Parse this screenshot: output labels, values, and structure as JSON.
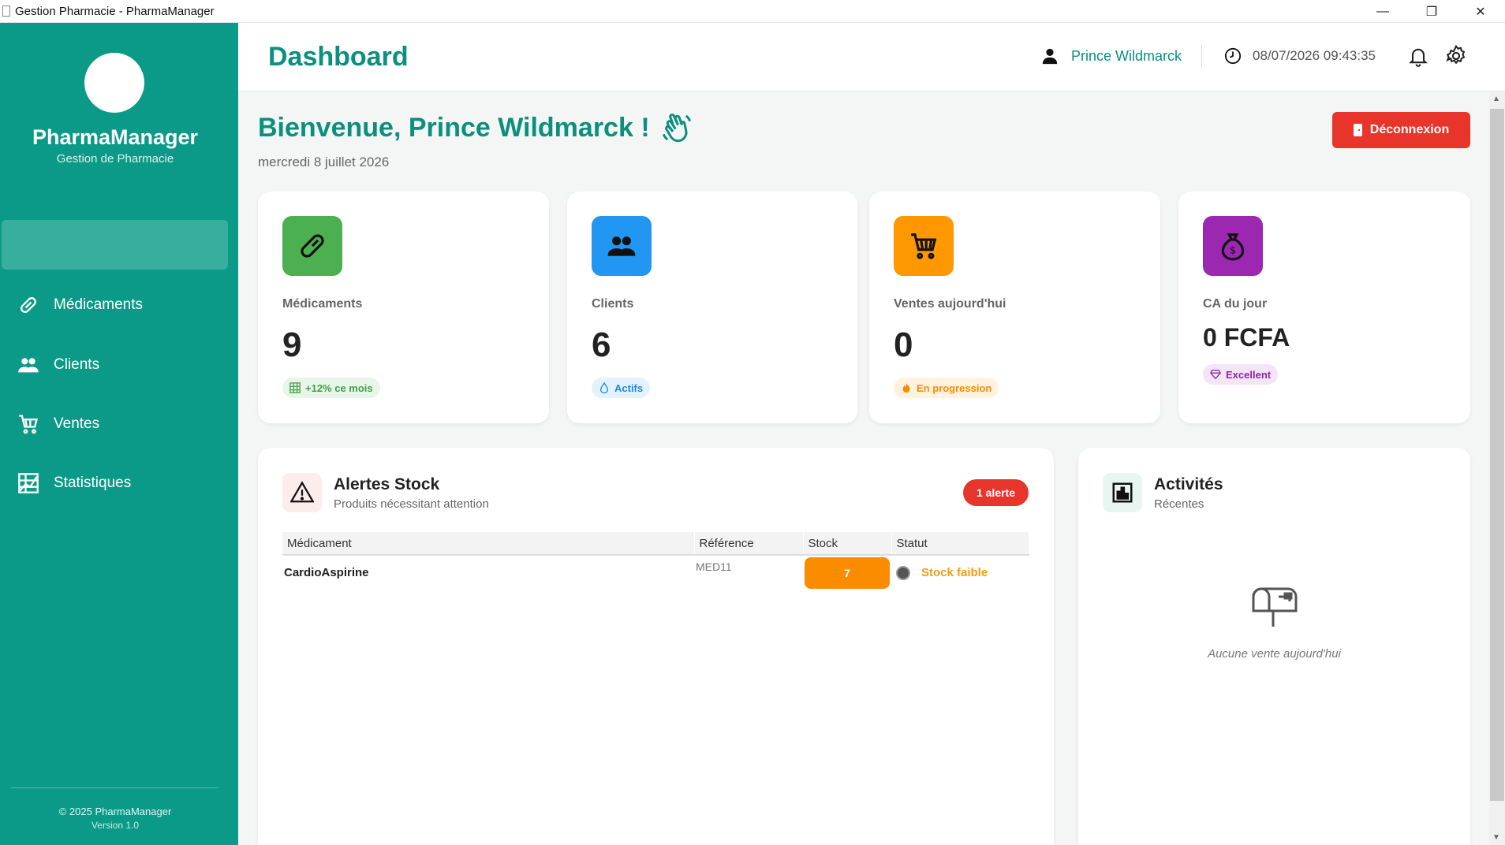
{
  "window": {
    "title": "Gestion Pharmacie - PharmaManager",
    "minimize": "—",
    "maximize": "❐",
    "close": "✕"
  },
  "sidebar": {
    "brand": "PharmaManager",
    "subtitle": "Gestion de Pharmacie",
    "items": [
      {
        "label": "Médicaments",
        "icon": "pill-icon"
      },
      {
        "label": "Clients",
        "icon": "users-icon"
      },
      {
        "label": "Ventes",
        "icon": "cart-icon"
      },
      {
        "label": "Statistiques",
        "icon": "chart-icon"
      }
    ],
    "copyright": "© 2025 PharmaManager",
    "version": "Version 1.0"
  },
  "header": {
    "title": "Dashboard",
    "user": "Prince Wildmarck",
    "datetime": "08/07/2026 09:43:35"
  },
  "welcome": {
    "greeting": "Bienvenue, Prince Wildmarck !",
    "date": "mercredi 8 juillet 2026",
    "logout": "Déconnexion"
  },
  "stats": [
    {
      "label": "Médicaments",
      "value": "9",
      "badge": "+12% ce mois",
      "color": "#4caf50"
    },
    {
      "label": "Clients",
      "value": "6",
      "badge": "Actifs",
      "color": "#2196f3"
    },
    {
      "label": "Ventes aujourd'hui",
      "value": "0",
      "badge": "En progression",
      "color": "#ff9800"
    },
    {
      "label": "CA du jour",
      "value": "0 FCFA",
      "badge": "Excellent",
      "color": "#9c27b0"
    }
  ],
  "alerts": {
    "title": "Alertes Stock",
    "subtitle": "Produits nécessitant attention",
    "count": "1 alerte",
    "columns": [
      "Médicament",
      "Référence",
      "Stock",
      "Statut"
    ],
    "rows": [
      {
        "name": "CardioAspirine",
        "ref": "MED11",
        "stock": "7",
        "status": "Stock faible"
      }
    ]
  },
  "activities": {
    "title": "Activités",
    "subtitle": "Récentes",
    "empty": "Aucune vente aujourd'hui"
  },
  "colors": {
    "primary": "#0b9a88",
    "danger": "#e8352b",
    "warning": "#fb8c00"
  }
}
